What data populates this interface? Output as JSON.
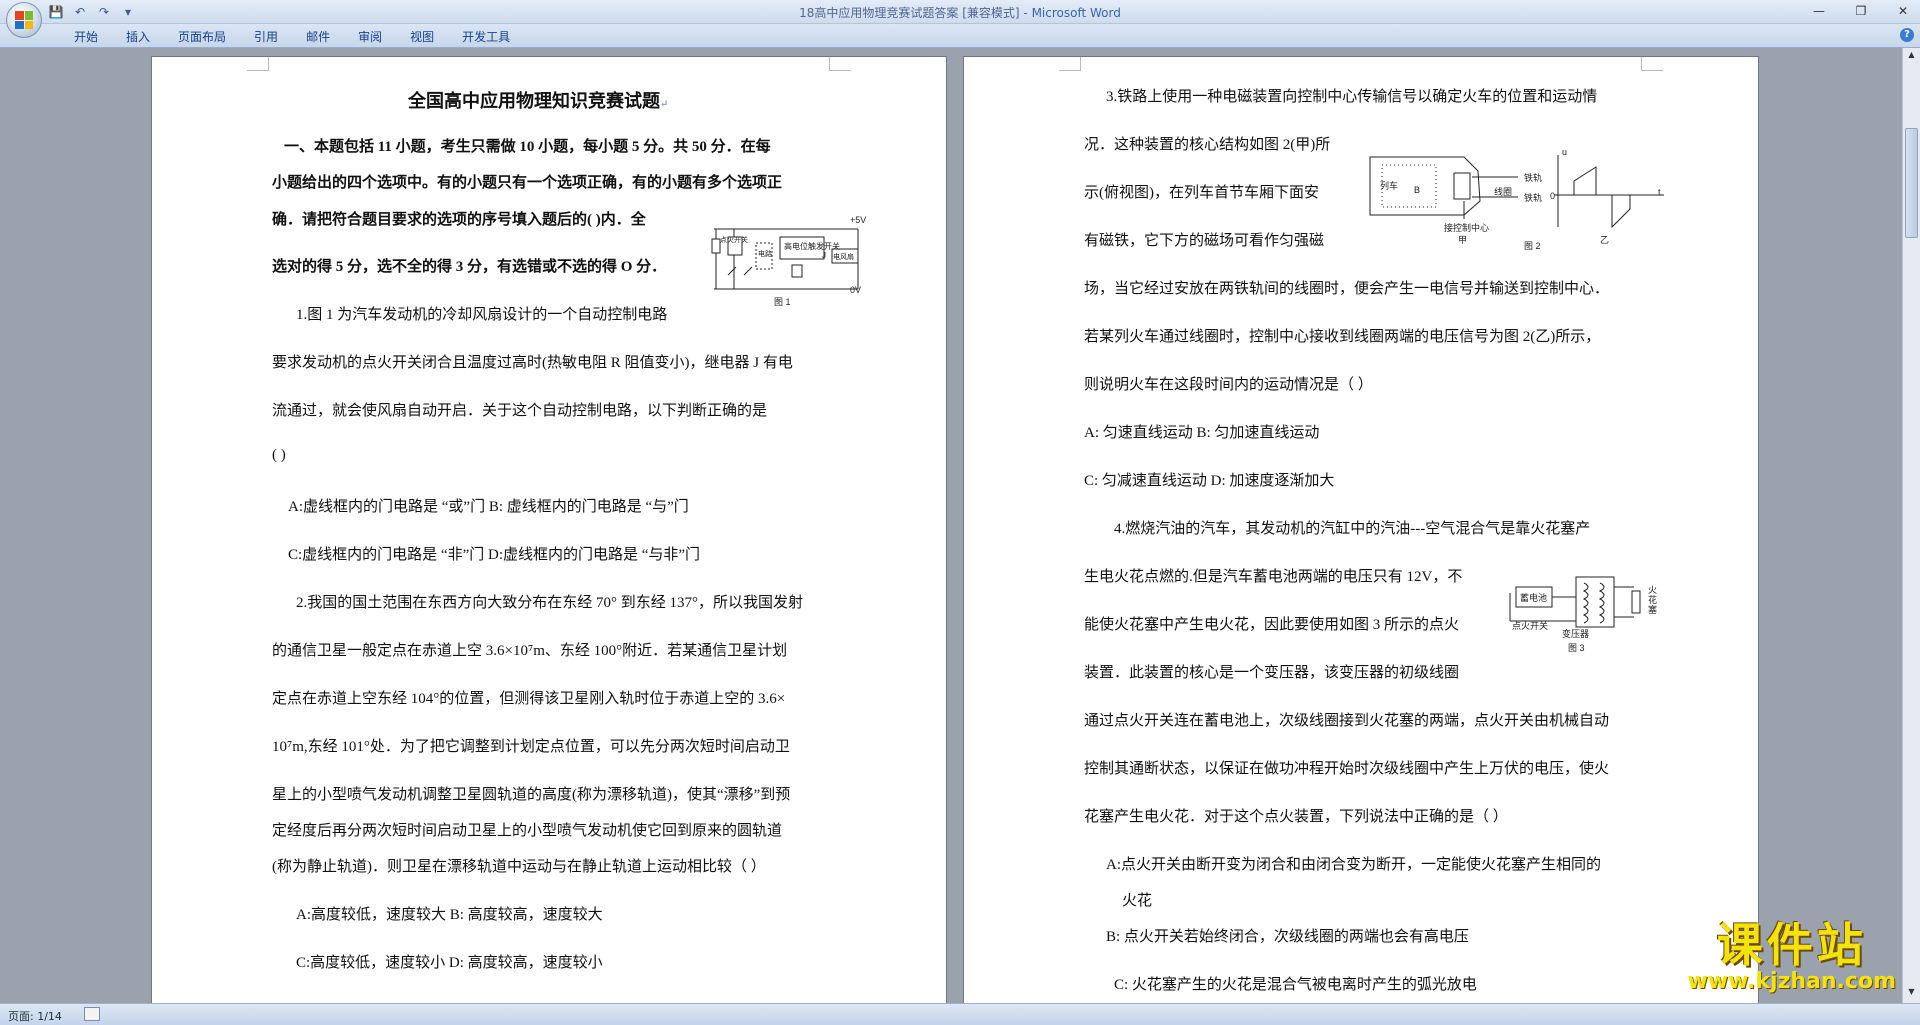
{
  "window": {
    "title": "18高中应用物理竞赛试题答案 [兼容模式] - ",
    "app": "Microsoft Word"
  },
  "qat": {
    "save": "💾",
    "undo": "↶",
    "redo": "↷",
    "more": "▾"
  },
  "winctl": {
    "min": "—",
    "max": "❐",
    "close": "✕"
  },
  "ribbon": {
    "tabs": [
      "开始",
      "插入",
      "页面布局",
      "引用",
      "邮件",
      "审阅",
      "视图",
      "开发工具"
    ],
    "help": "?"
  },
  "status": {
    "page": "页面: 1/14"
  },
  "watermark": {
    "text": "课件站",
    "url": "www.kjzhan.com"
  },
  "doc": {
    "left": {
      "title": "全国高中应用物理知识竞赛试题",
      "lines": [
        "一、本题包括 11 小题，考生只需做 10 小题，每小题 5 分。共 50 分．在每",
        "小题给出的四个选项中。有的小题只有一个选项正确，有的小题有多个选项正",
        "确．请把符合题目要求的选项的序号填入题后的(        )内．全",
        "选对的得 5 分，选不全的得 3 分，有选错或不选的得 O 分．",
        "1.图 1 为汽车发动机的冷却风扇设计的一个自动控制电路",
        "要求发动机的点火开关闭合且温度过高时(热敏电阻 R 阻值变小)，继电器 J 有电",
        "流通过，就会使风扇自动开启．关于这个自动控制电路，以下判断正确的是",
        "(        )",
        "A:虚线框内的门电路是 “或”门          B: 虚线框内的门电路是 “与”门",
        "C:虚线框内的门电路是 “非”门          D:虚线框内的门电路是 “与非”门",
        "2.我国的国土范围在东西方向大致分布在东经 70° 到东经 137°，所以我国发射",
        "的通信卫星一般定点在赤道上空 3.6×10⁷m、东经 100°附近．若某通信卫星计划",
        "定点在赤道上空东经 104°的位置，但测得该卫星刚入轨时位于赤道上空的 3.6×",
        "10⁷m,东经 101°处．为了把它调整到计划定点位置，可以先分两次短时间启动卫",
        "星上的小型喷气发动机调整卫星圆轨道的高度(称为漂移轨道)，使其“漂移”到预",
        "定经度后再分两次短时间启动卫星上的小型喷气发动机使它回到原来的圆轨道",
        "(称为静止轨道)．则卫星在漂移轨道中运动与在静止轨道上运动相比较（        ）",
        "A:高度较低，速度较大          B: 高度较高，速度较大",
        "C:高度较低，速度较小          D: 高度较高，速度较小"
      ],
      "fig1": {
        "caption": "图 1",
        "v5": "+5V",
        "v0": "0V",
        "box1": "点火开关",
        "box2": "高电位触发开关",
        "box3": "电路",
        "box4": "电风扇",
        "j": "J"
      }
    },
    "right": {
      "lines": [
        "3.铁路上使用一种电磁装置向控制中心传输信号以确定火车的位置和运动情",
        "况．这种装置的核心结构如图 2(甲)所",
        "示(俯视图)，在列车首节车厢下面安",
        "有磁铁，它下方的磁场可看作匀强磁",
        "场，当它经过安放在两铁轨间的线圈时，便会产生一电信号并输送到控制中心．",
        "若某列火车通过线圈时，控制中心接收到线圈两端的电压信号为图 2(乙)所示，",
        "则说明火车在这段时间内的运动情况是（        ）",
        "A:  匀速直线运动          B:  匀加速直线运动",
        "C:  匀减速直线运动        D:  加速度逐渐加大",
        "4.燃烧汽油的汽车，其发动机的汽缸中的汽油---空气混合气是靠火花塞产",
        "生电火花点燃的.但是汽车蓄电池两端的电压只有 12V，不",
        "能使火花塞中产生电火花，因此要使用如图 3 所示的点火",
        "装置．此装置的核心是一个变压器，该变压器的初级线圈",
        "通过点火开关连在蓄电池上，次级线圈接到火花塞的两端，点火开关由机械自动",
        "控制其通断状态，以保证在做功冲程开始时次级线圈中产生上万伏的电压，使火",
        "花塞产生电火花．对于这个点火装置，下列说法中正确的是（     ）",
        "A:点火开关由断开变为闭合和由闭合变为断开，一定能使火花塞产生相同的",
        "火花",
        "B:  点火开关若始终闭合，次级线圈的两端也会有高电压",
        "C:  火花塞产生的火花是混合气被电离时产生的弧光放电"
      ],
      "fig2": {
        "caption": "图 2",
        "jia": "甲",
        "yi": "乙",
        "car": "列车",
        "rail": "铁轨",
        "coil": "线圈",
        "to_center": "接控制中心",
        "B": "B",
        "u": "u",
        "t": "t",
        "o": "0"
      },
      "fig3": {
        "caption": "图 3",
        "battery": "蓄电池",
        "switch": "点火开关",
        "transformer": "变压器",
        "plug": "火花塞"
      }
    }
  }
}
